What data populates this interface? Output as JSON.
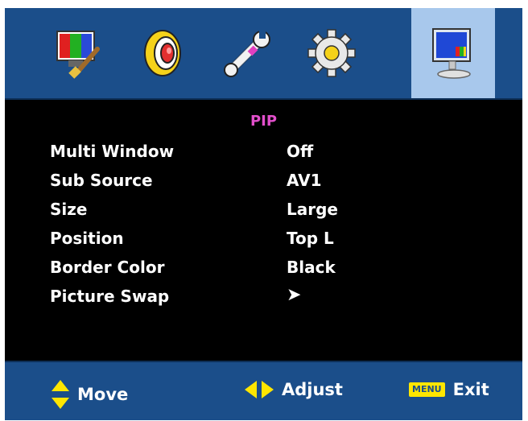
{
  "tabs": [
    {
      "name": "picture",
      "icon": "tv-picture-brush-icon",
      "active": false
    },
    {
      "name": "sound",
      "icon": "speaker-icon",
      "active": false
    },
    {
      "name": "tools",
      "icon": "wrench-icon",
      "active": false
    },
    {
      "name": "setup",
      "icon": "gear-icon",
      "active": false
    },
    {
      "name": "pip",
      "icon": "monitor-pip-icon",
      "active": true
    }
  ],
  "menu": {
    "title": "PIP",
    "items": [
      {
        "label": "Multi Window",
        "value": "Off"
      },
      {
        "label": "Sub Source",
        "value": "AV1"
      },
      {
        "label": "Size",
        "value": "Large"
      },
      {
        "label": "Position",
        "value": "Top L"
      },
      {
        "label": "Border Color",
        "value": "Black"
      },
      {
        "label": "Picture Swap",
        "value": "➤"
      }
    ]
  },
  "hints": {
    "move_label": "Move",
    "adjust_label": "Adjust",
    "menu_key": "MENU",
    "exit_label": "Exit"
  },
  "colors": {
    "bar": "#1b4e8a",
    "active_tab": "#a8c8ec",
    "title": "#e24fcb",
    "arrow_yellow": "#ffe600"
  }
}
